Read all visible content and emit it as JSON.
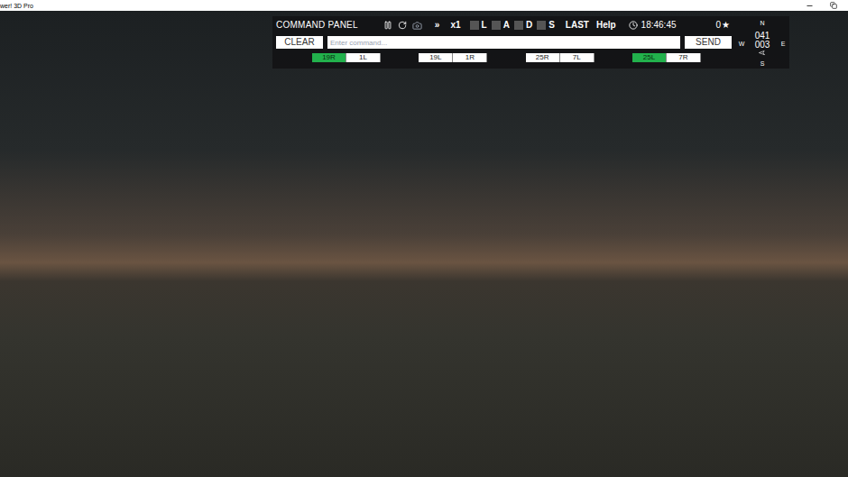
{
  "window": {
    "title": "wer! 3D Pro"
  },
  "command_panel": {
    "title": "COMMAND PANEL",
    "fast_forward": "»",
    "speed": "x1",
    "filters": [
      {
        "label": "L",
        "checked": false
      },
      {
        "label": "A",
        "checked": false
      },
      {
        "label": "D",
        "checked": false
      },
      {
        "label": "S",
        "checked": false
      }
    ],
    "last": "LAST",
    "help": "Help",
    "time": "18:46:45",
    "score": "0",
    "score_star": "★",
    "clear": "CLEAR",
    "placeholder": "Enter command...",
    "send": "SEND",
    "runway_pairs": [
      {
        "runways": [
          {
            "label": "19R",
            "selected": true
          },
          {
            "label": "1L",
            "selected": false
          }
        ]
      },
      {
        "runways": [
          {
            "label": "19L",
            "selected": false
          },
          {
            "label": "1R",
            "selected": false
          }
        ]
      },
      {
        "runways": [
          {
            "label": "25R",
            "selected": false
          },
          {
            "label": "7L",
            "selected": false
          }
        ]
      },
      {
        "runways": [
          {
            "label": "25L",
            "selected": true
          },
          {
            "label": "7R",
            "selected": false
          }
        ]
      }
    ],
    "compass": {
      "north": "N",
      "west": "W",
      "east": "E",
      "south": "S",
      "heading": "041",
      "wind": "003"
    }
  }
}
